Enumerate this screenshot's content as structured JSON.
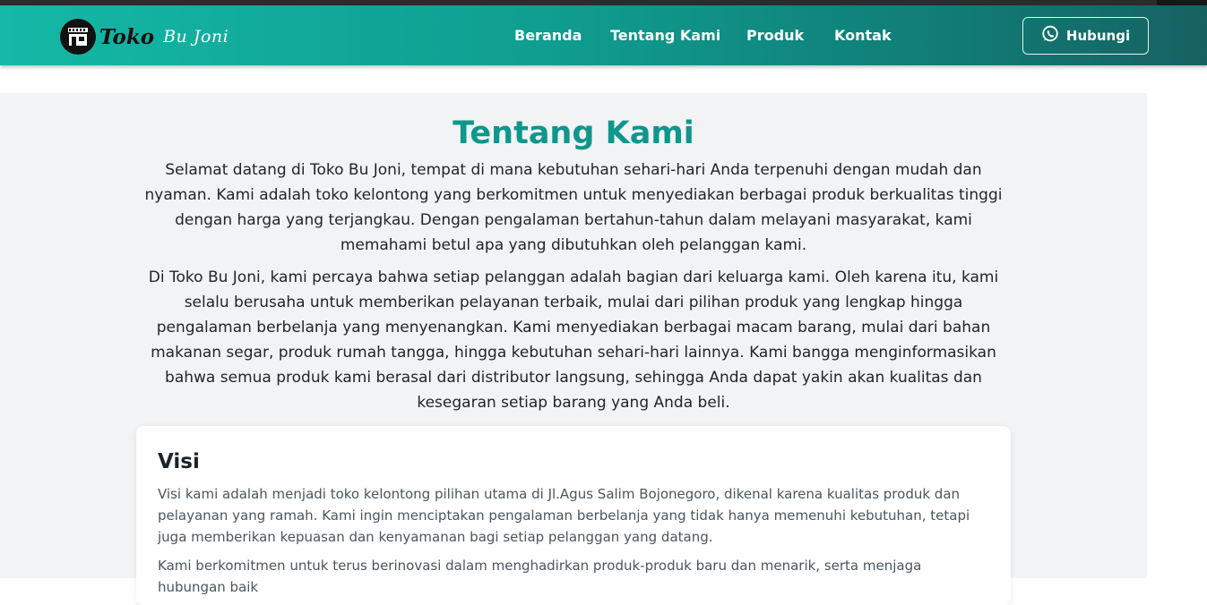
{
  "nav": {
    "logo_text": "Toko",
    "logo_script": "Bu Joni",
    "links": [
      "Beranda",
      "Tentang Kami",
      "Produk",
      "Kontak"
    ],
    "contact_button": "Hubungi",
    "logo_icon": "store-icon",
    "contact_icon": "whatsapp-icon"
  },
  "about": {
    "title": "Tentang Kami",
    "paragraph1": "Selamat datang di Toko Bu Joni, tempat di mana kebutuhan sehari-hari Anda terpenuhi dengan mudah dan nyaman. Kami adalah toko kelontong yang berkomitmen untuk menyediakan berbagai produk berkualitas tinggi dengan harga yang terjangkau. Dengan pengalaman bertahun-tahun dalam melayani masyarakat, kami memahami betul apa yang dibutuhkan oleh pelanggan kami.",
    "paragraph2": "Di Toko Bu Joni, kami percaya bahwa setiap pelanggan adalah bagian dari keluarga kami. Oleh karena itu, kami selalu berusaha untuk memberikan pelayanan terbaik, mulai dari pilihan produk yang lengkap hingga pengalaman berbelanja yang menyenangkan. Kami menyediakan berbagai macam barang, mulai dari bahan makanan segar, produk rumah tangga, hingga kebutuhan sehari-hari lainnya. Kami bangga menginformasikan bahwa semua produk kami berasal dari distributor langsung, sehingga Anda dapat yakin akan kualitas dan kesegaran setiap barang yang Anda beli."
  },
  "vision": {
    "title": "Visi",
    "text1": "Visi kami adalah menjadi toko kelontong pilihan utama di Jl.Agus Salim Bojonegoro, dikenal karena kualitas produk dan pelayanan yang ramah. Kami ingin menciptakan pengalaman berbelanja yang tidak hanya memenuhi kebutuhan, tetapi juga memberikan kepuasan dan kenyamanan bagi setiap pelanggan yang datang.",
    "text2": "Kami berkomitmen untuk terus berinovasi dalam menghadirkan produk-produk baru dan menarik, serta menjaga hubungan baik"
  },
  "colors": {
    "brand": "#0f968d",
    "nav_start": "#14b8a6",
    "nav_end": "#166261",
    "section_bg": "#f2f3f4"
  }
}
